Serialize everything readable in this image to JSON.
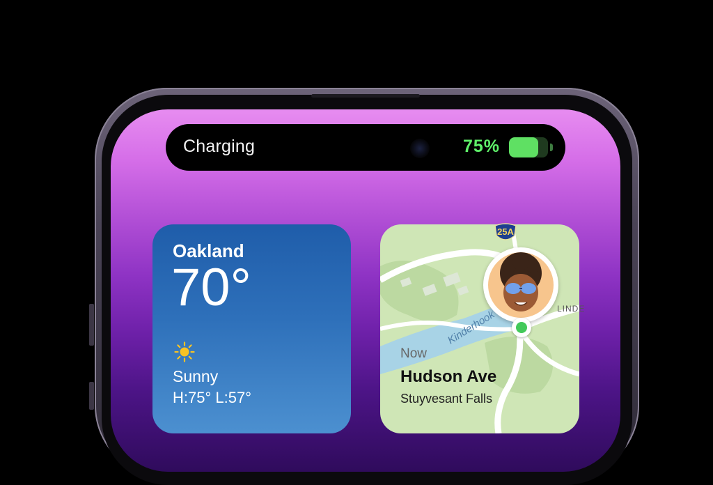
{
  "island": {
    "status_label": "Charging",
    "battery_percent_label": "75%",
    "battery_level": 0.75,
    "battery_color": "#5fe063"
  },
  "weather_widget": {
    "city": "Oakland",
    "temperature": "70°",
    "condition_icon": "sun-icon",
    "condition": "Sunny",
    "high_low": "H:75° L:57°"
  },
  "map_widget": {
    "route_shield": "25A",
    "river_label": "Kinderhook",
    "road_label": "LINDE",
    "time_label": "Now",
    "street": "Hudson Ave",
    "town": "Stuyvesant Falls",
    "location_pin_color": "#43c95a"
  },
  "colors": {
    "wallpaper_top": "#e78cf0",
    "wallpaper_bottom": "#2f0b5c",
    "weather_bg": "#2e70ba",
    "map_bg": "#cfe6b6"
  }
}
